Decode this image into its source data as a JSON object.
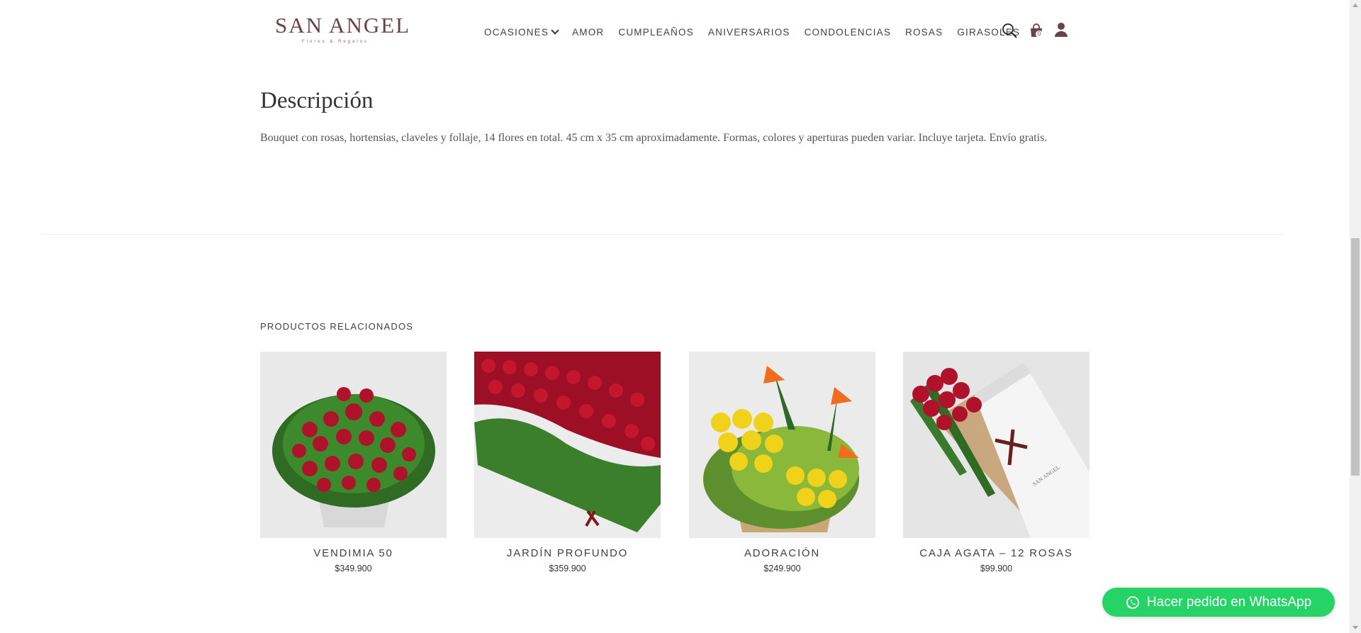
{
  "header": {
    "logo": {
      "main": "SAN ANGEL",
      "sub": "Flores & Regalos"
    },
    "nav": [
      {
        "label": "OCASIONES",
        "has_dropdown": true
      },
      {
        "label": "AMOR"
      },
      {
        "label": "CUMPLEAÑOS"
      },
      {
        "label": "ANIVERSARIOS"
      },
      {
        "label": "CONDOLENCIAS"
      },
      {
        "label": "ROSAS"
      },
      {
        "label": "GIRASOLES"
      }
    ],
    "icons": [
      "search-icon",
      "shopping-bag-icon",
      "user-icon"
    ],
    "cart_count": "0"
  },
  "description": {
    "title": "Descripción",
    "text": "Bouquet con rosas, hortensias, claveles y follaje, 14 flores en total. 45  cm x 35 cm aproximadamente. Formas, colores y aperturas pueden variar. Incluye tarjeta. Envío gratis."
  },
  "related": {
    "title": "PRODUCTOS RELACIONADOS",
    "products": [
      {
        "name": "VENDIMIA 50",
        "price": "$349.900",
        "image": "red-roses-basket"
      },
      {
        "name": "JARDÍN PROFUNDO",
        "price": "$359.900",
        "image": "red-roses-box"
      },
      {
        "name": "ADORACIÓN",
        "price": "$249.900",
        "image": "yellow-roses-bird-of-paradise"
      },
      {
        "name": "CAJA AGATA – 12 ROSAS",
        "price": "$99.900",
        "image": "roses-gift-box"
      }
    ]
  },
  "whatsapp": {
    "label": "Hacer pedido en WhatsApp",
    "color": "#25d366"
  },
  "colors": {
    "brand": "#6b4248",
    "text": "#3f3f46",
    "rose_red": "#b0122b",
    "leaf_green": "#3c7a2b"
  }
}
